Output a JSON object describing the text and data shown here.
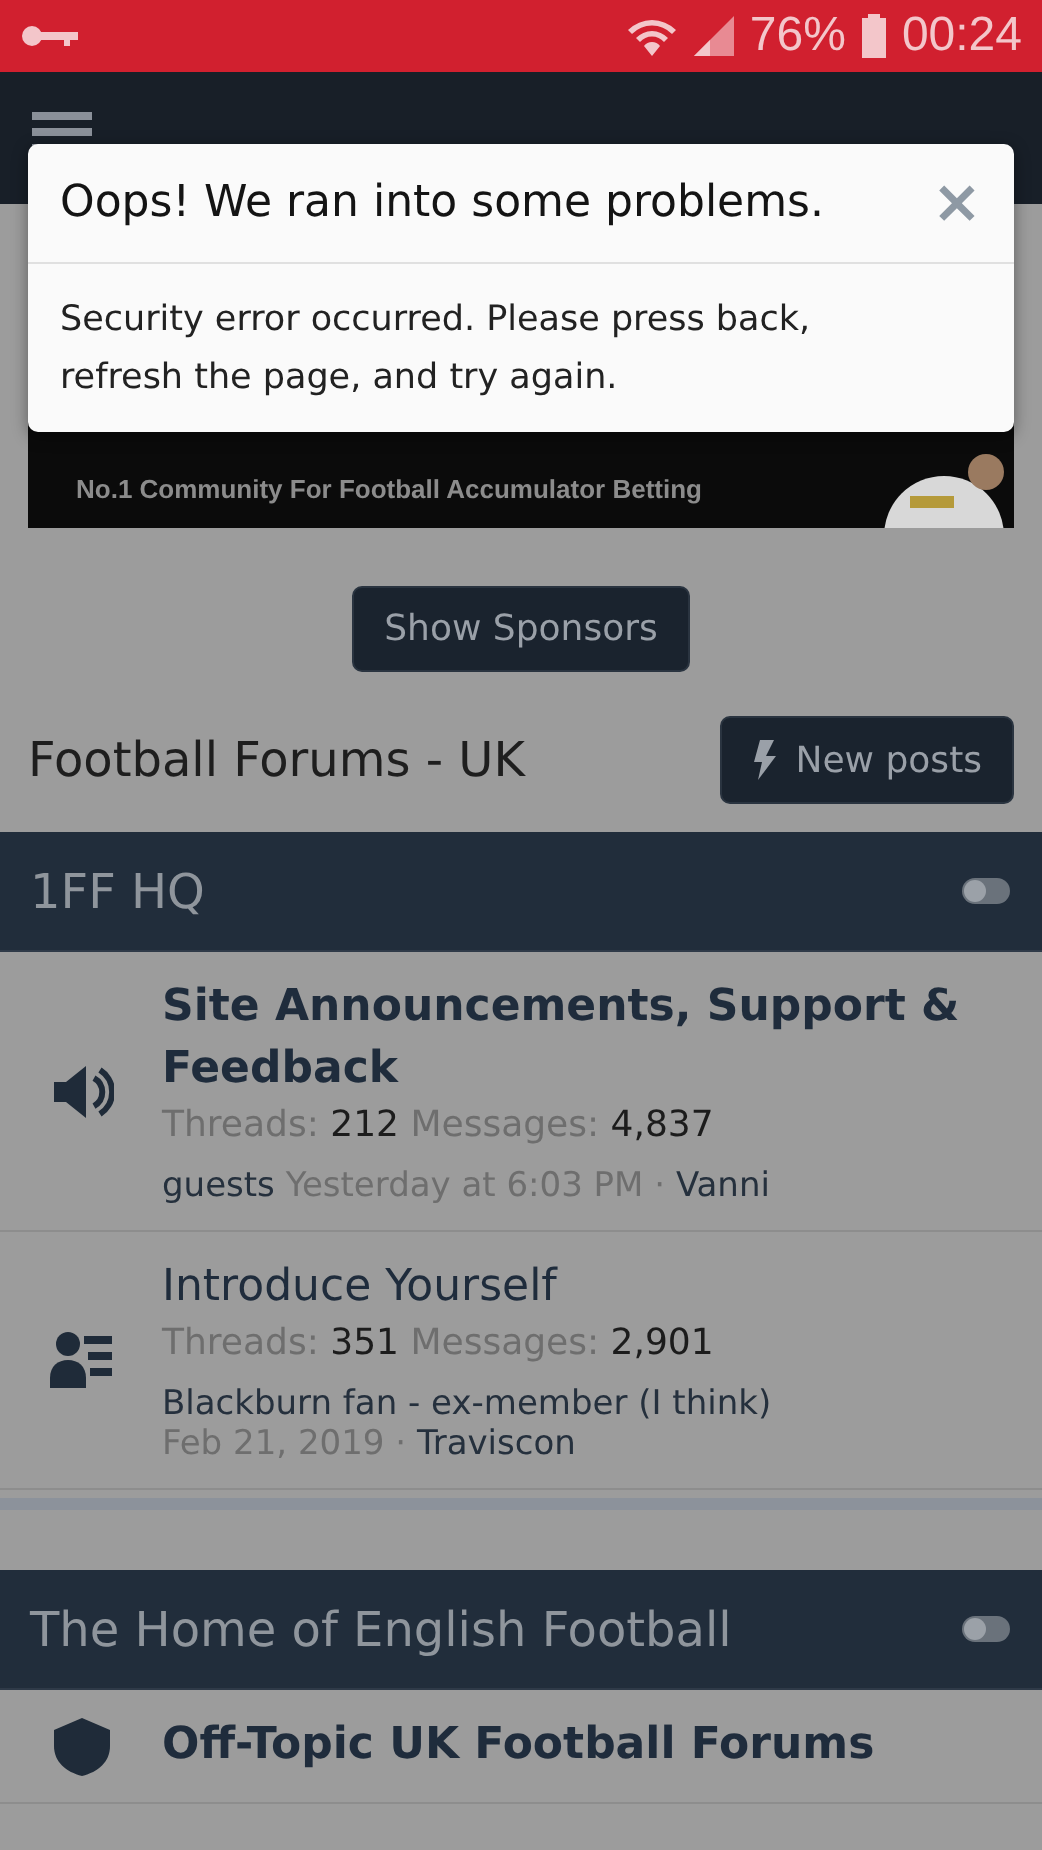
{
  "status_bar": {
    "battery": "76%",
    "time": "00:24"
  },
  "banner": {
    "tagline": "No.1 Community For Football Accumulator Betting"
  },
  "dialog": {
    "title": "Oops! We ran into some problems.",
    "close": "×",
    "message": "Security error occurred. Please press back, refresh the page, and try again."
  },
  "sponsors_button": "Show Sponsors",
  "page_title": "Football Forums - UK",
  "new_posts_button": "New posts",
  "sections": [
    {
      "title": "1FF HQ",
      "collapsed": false,
      "forums": [
        {
          "kind": "announcements",
          "title": "Site Announcements, Support & Feedback",
          "unread": true,
          "threads_label": "Threads:",
          "threads": "212",
          "messages_label": "Messages:",
          "messages": "4,837",
          "last_post": "guests",
          "date": "Yesterday at 6:03 PM",
          "separator": "·",
          "author": "Vanni"
        },
        {
          "kind": "members",
          "title": "Introduce Yourself",
          "unread": false,
          "threads_label": "Threads:",
          "threads": "351",
          "messages_label": "Messages:",
          "messages": "2,901",
          "last_post": "Blackburn fan - ex-member (I think)",
          "date": "Feb 21, 2019",
          "separator": "·",
          "author": "Traviscon"
        }
      ]
    },
    {
      "title": "The Home of English Football",
      "collapsed": false,
      "forums": [
        {
          "kind": "club",
          "title": "Off-Topic UK Football Forums",
          "unread": true
        }
      ]
    }
  ]
}
